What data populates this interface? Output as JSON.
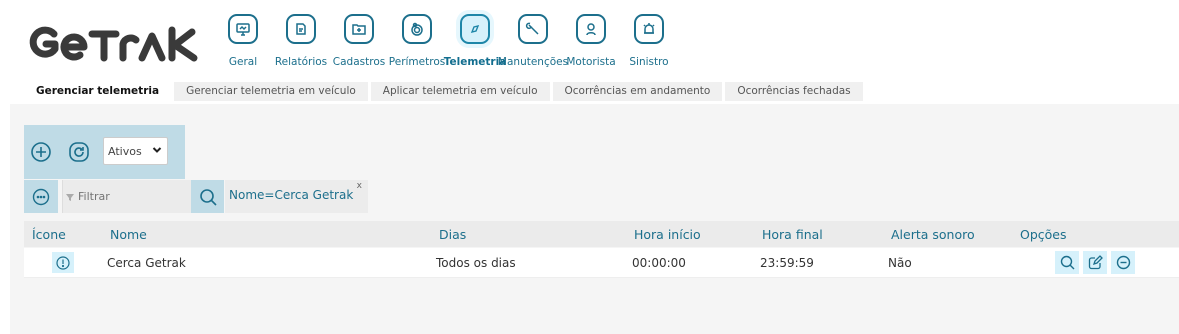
{
  "logo": {
    "text": "GeTraK"
  },
  "nav": {
    "items": [
      {
        "label": "Geral",
        "icon": "monitor-icon"
      },
      {
        "label": "Relatórios",
        "icon": "report-icon"
      },
      {
        "label": "Cadastros",
        "icon": "folder-add-icon"
      },
      {
        "label": "Perímetros",
        "icon": "target-icon"
      },
      {
        "label": "Telemetria",
        "icon": "compass-icon",
        "active": true
      },
      {
        "label": "Manutenções",
        "icon": "wrench-icon"
      },
      {
        "label": "Motorista",
        "icon": "driver-icon"
      },
      {
        "label": "Sinistro",
        "icon": "siren-icon"
      }
    ]
  },
  "tabs": [
    {
      "label": "Gerenciar telemetria",
      "active": true
    },
    {
      "label": "Gerenciar telemetria em veículo"
    },
    {
      "label": "Aplicar telemetria em veículo"
    },
    {
      "label": "Ocorrências em andamento"
    },
    {
      "label": "Ocorrências fechadas"
    }
  ],
  "toolbar": {
    "status_select": "Ativos"
  },
  "filter": {
    "placeholder": "Filtrar",
    "chip": "Nome=Cerca Getrak",
    "chip_close": "x"
  },
  "table": {
    "headers": {
      "icone": "Ícone",
      "nome": "Nome",
      "dias": "Dias",
      "hora_inicio": "Hora início",
      "hora_final": "Hora final",
      "alerta": "Alerta sonoro",
      "opcoes": "Opções"
    },
    "rows": [
      {
        "nome": "Cerca Getrak",
        "dias": "Todos os dias",
        "hora_inicio": "00:00:00",
        "hora_final": "23:59:59",
        "alerta": "Não"
      }
    ]
  },
  "colors": {
    "accent": "#1c6f8c",
    "accent_light": "#bfdbe6",
    "highlight": "#d6f1fb"
  }
}
